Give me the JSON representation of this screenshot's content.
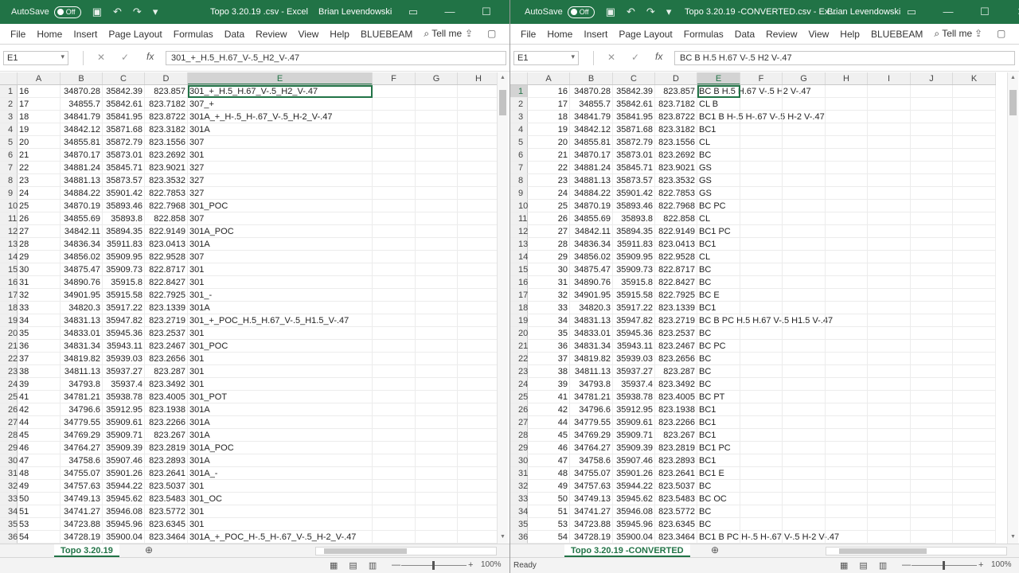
{
  "left": {
    "autosave": "AutoSave",
    "autosave_state": "Off",
    "title": "Topo 3.20.19 .csv  -  Excel",
    "user": "Brian Levendowski",
    "tabs": [
      "File",
      "Home",
      "Insert",
      "Page Layout",
      "Formulas",
      "Data",
      "Review",
      "View",
      "Help",
      "BLUEBEAM"
    ],
    "tell_me": "Tell me",
    "name_box": "E1",
    "formula": "301_+_H.5_H.67_V-.5_H2_V-.47",
    "columns": [
      "A",
      "B",
      "C",
      "D",
      "E",
      "F",
      "G",
      "H"
    ],
    "rows": [
      [
        "16",
        "34870.28",
        "35842.39",
        "823.857",
        "301_+_H.5_H.67_V-.5_H2_V-.47"
      ],
      [
        "17",
        "34855.7",
        "35842.61",
        "823.7182",
        "307_+"
      ],
      [
        "18",
        "34841.79",
        "35841.95",
        "823.8722",
        "301A_+_H-.5_H-.67_V-.5_H-2_V-.47"
      ],
      [
        "19",
        "34842.12",
        "35871.68",
        "823.3182",
        "301A"
      ],
      [
        "20",
        "34855.81",
        "35872.79",
        "823.1556",
        "307"
      ],
      [
        "21",
        "34870.17",
        "35873.01",
        "823.2692",
        "301"
      ],
      [
        "22",
        "34881.24",
        "35845.71",
        "823.9021",
        "327"
      ],
      [
        "23",
        "34881.13",
        "35873.57",
        "823.3532",
        "327"
      ],
      [
        "24",
        "34884.22",
        "35901.42",
        "822.7853",
        "327"
      ],
      [
        "25",
        "34870.19",
        "35893.46",
        "822.7968",
        "301_POC"
      ],
      [
        "26",
        "34855.69",
        "35893.8",
        "822.858",
        "307"
      ],
      [
        "27",
        "34842.11",
        "35894.35",
        "822.9149",
        "301A_POC"
      ],
      [
        "28",
        "34836.34",
        "35911.83",
        "823.0413",
        "301A"
      ],
      [
        "29",
        "34856.02",
        "35909.95",
        "822.9528",
        "307"
      ],
      [
        "30",
        "34875.47",
        "35909.73",
        "822.8717",
        "301"
      ],
      [
        "31",
        "34890.76",
        "35915.8",
        "822.8427",
        "301"
      ],
      [
        "32",
        "34901.95",
        "35915.58",
        "822.7925",
        "301_-"
      ],
      [
        "33",
        "34820.3",
        "35917.22",
        "823.1339",
        "301A"
      ],
      [
        "34",
        "34831.13",
        "35947.82",
        "823.2719",
        "301_+_POC_H.5_H.67_V-.5_H1.5_V-.47"
      ],
      [
        "35",
        "34833.01",
        "35945.36",
        "823.2537",
        "301"
      ],
      [
        "36",
        "34831.34",
        "35943.11",
        "823.2467",
        "301_POC"
      ],
      [
        "37",
        "34819.82",
        "35939.03",
        "823.2656",
        "301"
      ],
      [
        "38",
        "34811.13",
        "35937.27",
        "823.287",
        "301"
      ],
      [
        "39",
        "34793.8",
        "35937.4",
        "823.3492",
        "301"
      ],
      [
        "41",
        "34781.21",
        "35938.78",
        "823.4005",
        "301_POT"
      ],
      [
        "42",
        "34796.6",
        "35912.95",
        "823.1938",
        "301A"
      ],
      [
        "44",
        "34779.55",
        "35909.61",
        "823.2266",
        "301A"
      ],
      [
        "45",
        "34769.29",
        "35909.71",
        "823.267",
        "301A"
      ],
      [
        "46",
        "34764.27",
        "35909.39",
        "823.2819",
        "301A_POC"
      ],
      [
        "47",
        "34758.6",
        "35907.46",
        "823.2893",
        "301A"
      ],
      [
        "48",
        "34755.07",
        "35901.26",
        "823.2641",
        "301A_-"
      ],
      [
        "49",
        "34757.63",
        "35944.22",
        "823.5037",
        "301"
      ],
      [
        "50",
        "34749.13",
        "35945.62",
        "823.5483",
        "301_OC"
      ],
      [
        "51",
        "34741.27",
        "35946.08",
        "823.5772",
        "301"
      ],
      [
        "53",
        "34723.88",
        "35945.96",
        "823.6345",
        "301"
      ],
      [
        "54",
        "34728.19",
        "35900.04",
        "823.3464",
        "301A_+_POC_H-.5_H-.67_V-.5_H-2_V-.47"
      ]
    ],
    "sheet_tab": "Topo 3.20.19",
    "zoom": "100%"
  },
  "right": {
    "autosave": "AutoSave",
    "autosave_state": "Off",
    "title": "Topo 3.20.19 -CONVERTED.csv  -  Ex...",
    "user": "Brian Levendowski",
    "tabs": [
      "File",
      "Home",
      "Insert",
      "Page Layout",
      "Formulas",
      "Data",
      "Review",
      "View",
      "Help",
      "BLUEBEAM"
    ],
    "tell_me": "Tell me",
    "name_box": "E1",
    "formula": "BC B H.5 H.67 V-.5 H2 V-.47",
    "columns": [
      "A",
      "B",
      "C",
      "D",
      "E",
      "F",
      "G",
      "H",
      "I",
      "J",
      "K"
    ],
    "rows": [
      [
        "16",
        "34870.28",
        "35842.39",
        "823.857",
        "BC B H.5 H.67 V-.5 H2 V-.47"
      ],
      [
        "17",
        "34855.7",
        "35842.61",
        "823.7182",
        "CL B"
      ],
      [
        "18",
        "34841.79",
        "35841.95",
        "823.8722",
        "BC1 B H-.5 H-.67 V-.5 H-2 V-.47"
      ],
      [
        "19",
        "34842.12",
        "35871.68",
        "823.3182",
        "BC1"
      ],
      [
        "20",
        "34855.81",
        "35872.79",
        "823.1556",
        "CL"
      ],
      [
        "21",
        "34870.17",
        "35873.01",
        "823.2692",
        "BC"
      ],
      [
        "22",
        "34881.24",
        "35845.71",
        "823.9021",
        "GS"
      ],
      [
        "23",
        "34881.13",
        "35873.57",
        "823.3532",
        "GS"
      ],
      [
        "24",
        "34884.22",
        "35901.42",
        "822.7853",
        "GS"
      ],
      [
        "25",
        "34870.19",
        "35893.46",
        "822.7968",
        "BC PC"
      ],
      [
        "26",
        "34855.69",
        "35893.8",
        "822.858",
        "CL"
      ],
      [
        "27",
        "34842.11",
        "35894.35",
        "822.9149",
        "BC1 PC"
      ],
      [
        "28",
        "34836.34",
        "35911.83",
        "823.0413",
        "BC1"
      ],
      [
        "29",
        "34856.02",
        "35909.95",
        "822.9528",
        "CL"
      ],
      [
        "30",
        "34875.47",
        "35909.73",
        "822.8717",
        "BC"
      ],
      [
        "31",
        "34890.76",
        "35915.8",
        "822.8427",
        "BC"
      ],
      [
        "32",
        "34901.95",
        "35915.58",
        "822.7925",
        "BC E"
      ],
      [
        "33",
        "34820.3",
        "35917.22",
        "823.1339",
        "BC1"
      ],
      [
        "34",
        "34831.13",
        "35947.82",
        "823.2719",
        "BC B PC H.5 H.67 V-.5 H1.5 V-.47"
      ],
      [
        "35",
        "34833.01",
        "35945.36",
        "823.2537",
        "BC"
      ],
      [
        "36",
        "34831.34",
        "35943.11",
        "823.2467",
        "BC PC"
      ],
      [
        "37",
        "34819.82",
        "35939.03",
        "823.2656",
        "BC"
      ],
      [
        "38",
        "34811.13",
        "35937.27",
        "823.287",
        "BC"
      ],
      [
        "39",
        "34793.8",
        "35937.4",
        "823.3492",
        "BC"
      ],
      [
        "41",
        "34781.21",
        "35938.78",
        "823.4005",
        "BC PT"
      ],
      [
        "42",
        "34796.6",
        "35912.95",
        "823.1938",
        "BC1"
      ],
      [
        "44",
        "34779.55",
        "35909.61",
        "823.2266",
        "BC1"
      ],
      [
        "45",
        "34769.29",
        "35909.71",
        "823.267",
        "BC1"
      ],
      [
        "46",
        "34764.27",
        "35909.39",
        "823.2819",
        "BC1 PC"
      ],
      [
        "47",
        "34758.6",
        "35907.46",
        "823.2893",
        "BC1"
      ],
      [
        "48",
        "34755.07",
        "35901.26",
        "823.2641",
        "BC1 E"
      ],
      [
        "49",
        "34757.63",
        "35944.22",
        "823.5037",
        "BC"
      ],
      [
        "50",
        "34749.13",
        "35945.62",
        "823.5483",
        "BC OC"
      ],
      [
        "51",
        "34741.27",
        "35946.08",
        "823.5772",
        "BC"
      ],
      [
        "53",
        "34723.88",
        "35945.96",
        "823.6345",
        "BC"
      ],
      [
        "54",
        "34728.19",
        "35900.04",
        "823.3464",
        "BC1 B PC H-.5 H-.67 V-.5 H-2 V-.47"
      ]
    ],
    "sheet_tab": "Topo 3.20.19 -CONVERTED",
    "status": "Ready",
    "zoom": "100%"
  },
  "icons": {
    "save": "save-icon",
    "undo": "undo-icon",
    "redo": "redo-icon",
    "search": "search-icon",
    "share": "share-icon",
    "comment": "comment-icon",
    "minimize": "minimize-icon",
    "maximize": "maximize-icon",
    "close": "close-icon",
    "cancel": "cancel-formula-icon",
    "enter": "enter-formula-icon",
    "fx": "insert-function-icon"
  },
  "colors": {
    "accent": "#217346"
  }
}
